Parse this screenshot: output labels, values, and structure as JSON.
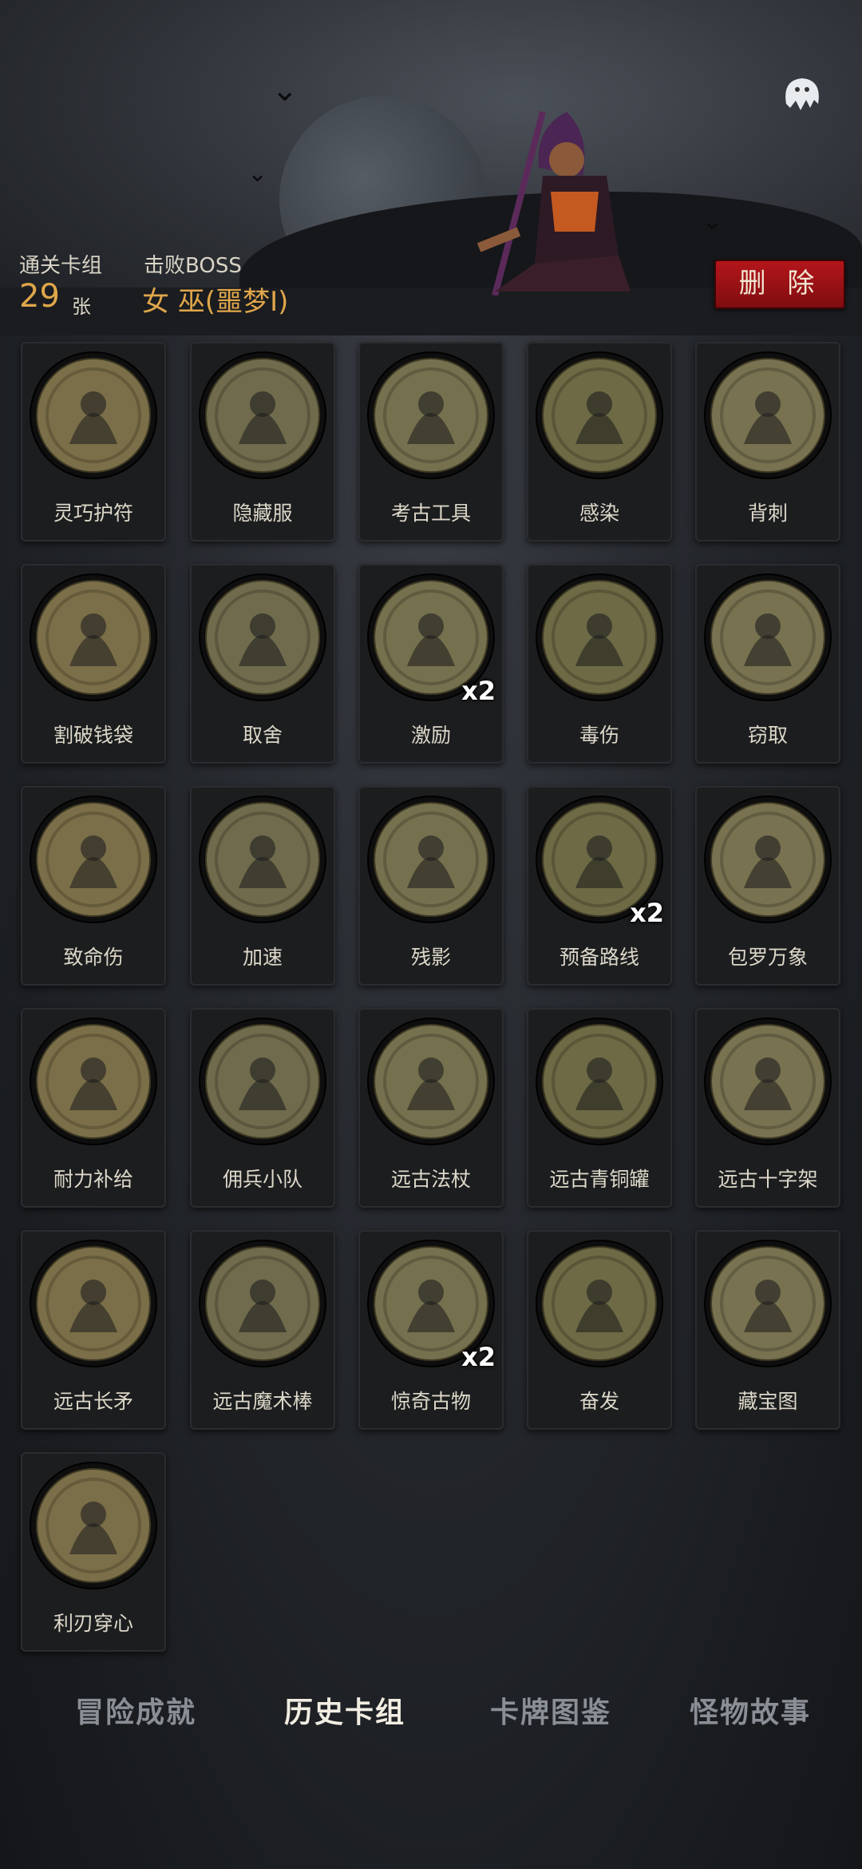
{
  "header": {
    "cleared_deck_label": "通关卡组",
    "cleared_count": "29",
    "cleared_unit": "张",
    "boss_label": "击败BOSS",
    "boss_name": "女 巫(噩梦I)",
    "delete_label": "删 除"
  },
  "cards": [
    {
      "label": "灵巧护符",
      "icon": "amulet-icon",
      "mult": ""
    },
    {
      "label": "隐藏服",
      "icon": "hooded-cloak-icon",
      "mult": ""
    },
    {
      "label": "考古工具",
      "icon": "archaeology-tools-icon",
      "mult": ""
    },
    {
      "label": "感染",
      "icon": "infected-goblin-icon",
      "mult": ""
    },
    {
      "label": "背刺",
      "icon": "backstab-icon",
      "mult": ""
    },
    {
      "label": "割破钱袋",
      "icon": "cut-purse-icon",
      "mult": ""
    },
    {
      "label": "取舍",
      "icon": "wizard-icon",
      "mult": ""
    },
    {
      "label": "激励",
      "icon": "hammer-strike-icon",
      "mult": "x2"
    },
    {
      "label": "毒伤",
      "icon": "poison-monster-icon",
      "mult": ""
    },
    {
      "label": "窃取",
      "icon": "goblin-thief-icon",
      "mult": ""
    },
    {
      "label": "致命伤",
      "icon": "fatal-wound-icon",
      "mult": ""
    },
    {
      "label": "加速",
      "icon": "speed-witch-icon",
      "mult": ""
    },
    {
      "label": "残影",
      "icon": "afterimage-icon",
      "mult": ""
    },
    {
      "label": "预备路线",
      "icon": "route-map-icon",
      "mult": "x2"
    },
    {
      "label": "包罗万象",
      "icon": "all-encompassing-icon",
      "mult": ""
    },
    {
      "label": "耐力补给",
      "icon": "stamina-potion-icon",
      "mult": ""
    },
    {
      "label": "佣兵小队",
      "icon": "mercenary-squad-icon",
      "mult": ""
    },
    {
      "label": "远古法杖",
      "icon": "ancient-staff-icon",
      "mult": ""
    },
    {
      "label": "远古青铜罐",
      "icon": "bronze-urn-icon",
      "mult": ""
    },
    {
      "label": "远古十字架",
      "icon": "ancient-cross-icon",
      "mult": ""
    },
    {
      "label": "远古长矛",
      "icon": "ancient-spear-icon",
      "mult": ""
    },
    {
      "label": "远古魔术棒",
      "icon": "magic-wand-icon",
      "mult": ""
    },
    {
      "label": "惊奇古物",
      "icon": "curious-relic-icon",
      "mult": "x2"
    },
    {
      "label": "奋发",
      "icon": "dumbbell-hero-icon",
      "mult": ""
    },
    {
      "label": "藏宝图",
      "icon": "treasure-map-icon",
      "mult": ""
    },
    {
      "label": "利刃穿心",
      "icon": "blade-heart-icon",
      "mult": ""
    }
  ],
  "tabs": [
    {
      "label": "冒险成就",
      "active": false
    },
    {
      "label": "历史卡组",
      "active": true
    },
    {
      "label": "卡牌图鉴",
      "active": false
    },
    {
      "label": "怪物故事",
      "active": false
    }
  ],
  "colors": {
    "medal_face": "#6e6a47",
    "accent_gold": "#e0a64a",
    "delete_red": "#b3161b"
  }
}
